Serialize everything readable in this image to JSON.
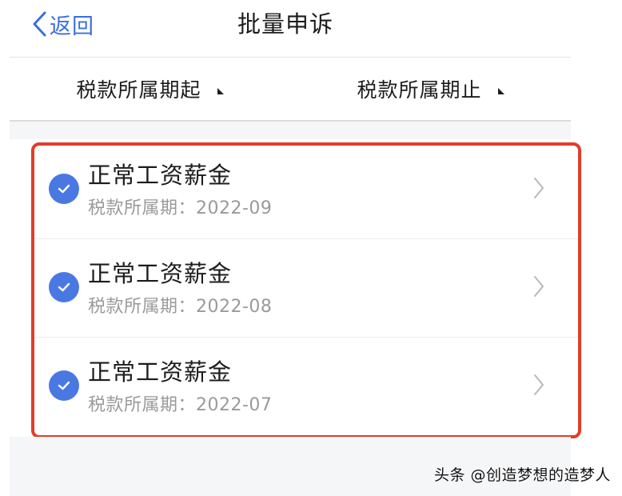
{
  "header": {
    "back_label": "返回",
    "title": "批量申诉"
  },
  "filters": {
    "start_label": "税款所属期起",
    "end_label": "税款所属期止"
  },
  "items": [
    {
      "title": "正常工资薪金",
      "subtitle": "税款所属期：2022-09",
      "selected": true
    },
    {
      "title": "正常工资薪金",
      "subtitle": "税款所属期：2022-08",
      "selected": true
    },
    {
      "title": "正常工资薪金",
      "subtitle": "税款所属期：2022-07",
      "selected": true
    }
  ],
  "colors": {
    "accent": "#3b6fe0",
    "check": "#4a78e3",
    "highlight": "#e23c2c"
  },
  "icons": {
    "back": "chevron-left-icon",
    "filter_caret": "caret-icon",
    "check": "check-circle-icon",
    "row_arrow": "chevron-right-icon"
  },
  "watermark": "头条 @创造梦想的造梦人"
}
